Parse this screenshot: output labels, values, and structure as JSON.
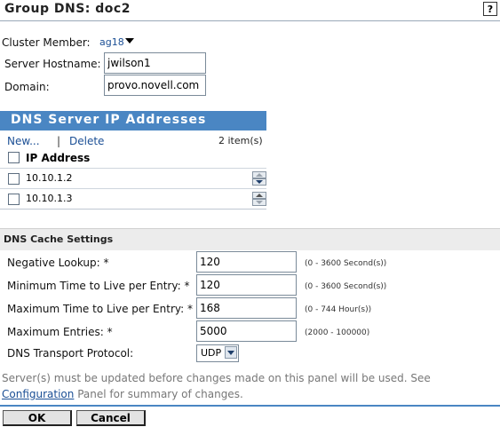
{
  "header": {
    "title": "Group DNS: doc2",
    "help_label": "?"
  },
  "form": {
    "cluster_member_label": "Cluster Member:",
    "cluster_member_value": "ag18",
    "server_hostname_label": "Server Hostname:",
    "server_hostname_value": "jwilson1",
    "domain_label": "Domain:",
    "domain_value": "provo.novell.com"
  },
  "dns_table": {
    "title": "DNS Server IP Addresses",
    "new_label": "New...",
    "separator": "|",
    "delete_label": "Delete",
    "count_label": "2 item(s)",
    "column_header": "IP Address",
    "rows": [
      {
        "ip": "10.10.1.2"
      },
      {
        "ip": "10.10.1.3"
      }
    ]
  },
  "cache": {
    "section_title": "DNS Cache Settings",
    "negative_lookup_label": "Negative Lookup: *",
    "negative_lookup_value": "120",
    "negative_lookup_hint": "(0 - 3600 Second(s))",
    "min_ttl_label": "Minimum Time to Live per Entry: *",
    "min_ttl_value": "120",
    "min_ttl_hint": "(0 - 3600 Second(s))",
    "max_ttl_label": "Maximum Time to Live per Entry: *",
    "max_ttl_value": "168",
    "max_ttl_hint": "(0 - 744 Hour(s))",
    "max_entries_label": "Maximum Entries: *",
    "max_entries_value": "5000",
    "max_entries_hint": "(2000 - 100000)",
    "transport_label": "DNS Transport Protocol:",
    "transport_value": "UDP"
  },
  "message": {
    "text_before": "Server(s) must be updated before changes made on this panel will be used. See ",
    "link": "Configuration",
    "text_after": " Panel for summary of changes."
  },
  "buttons": {
    "ok": "OK",
    "cancel": "Cancel"
  },
  "colors": {
    "accent": "#4a86c3",
    "link": "#1b4f95",
    "section_bg": "#ececec"
  }
}
